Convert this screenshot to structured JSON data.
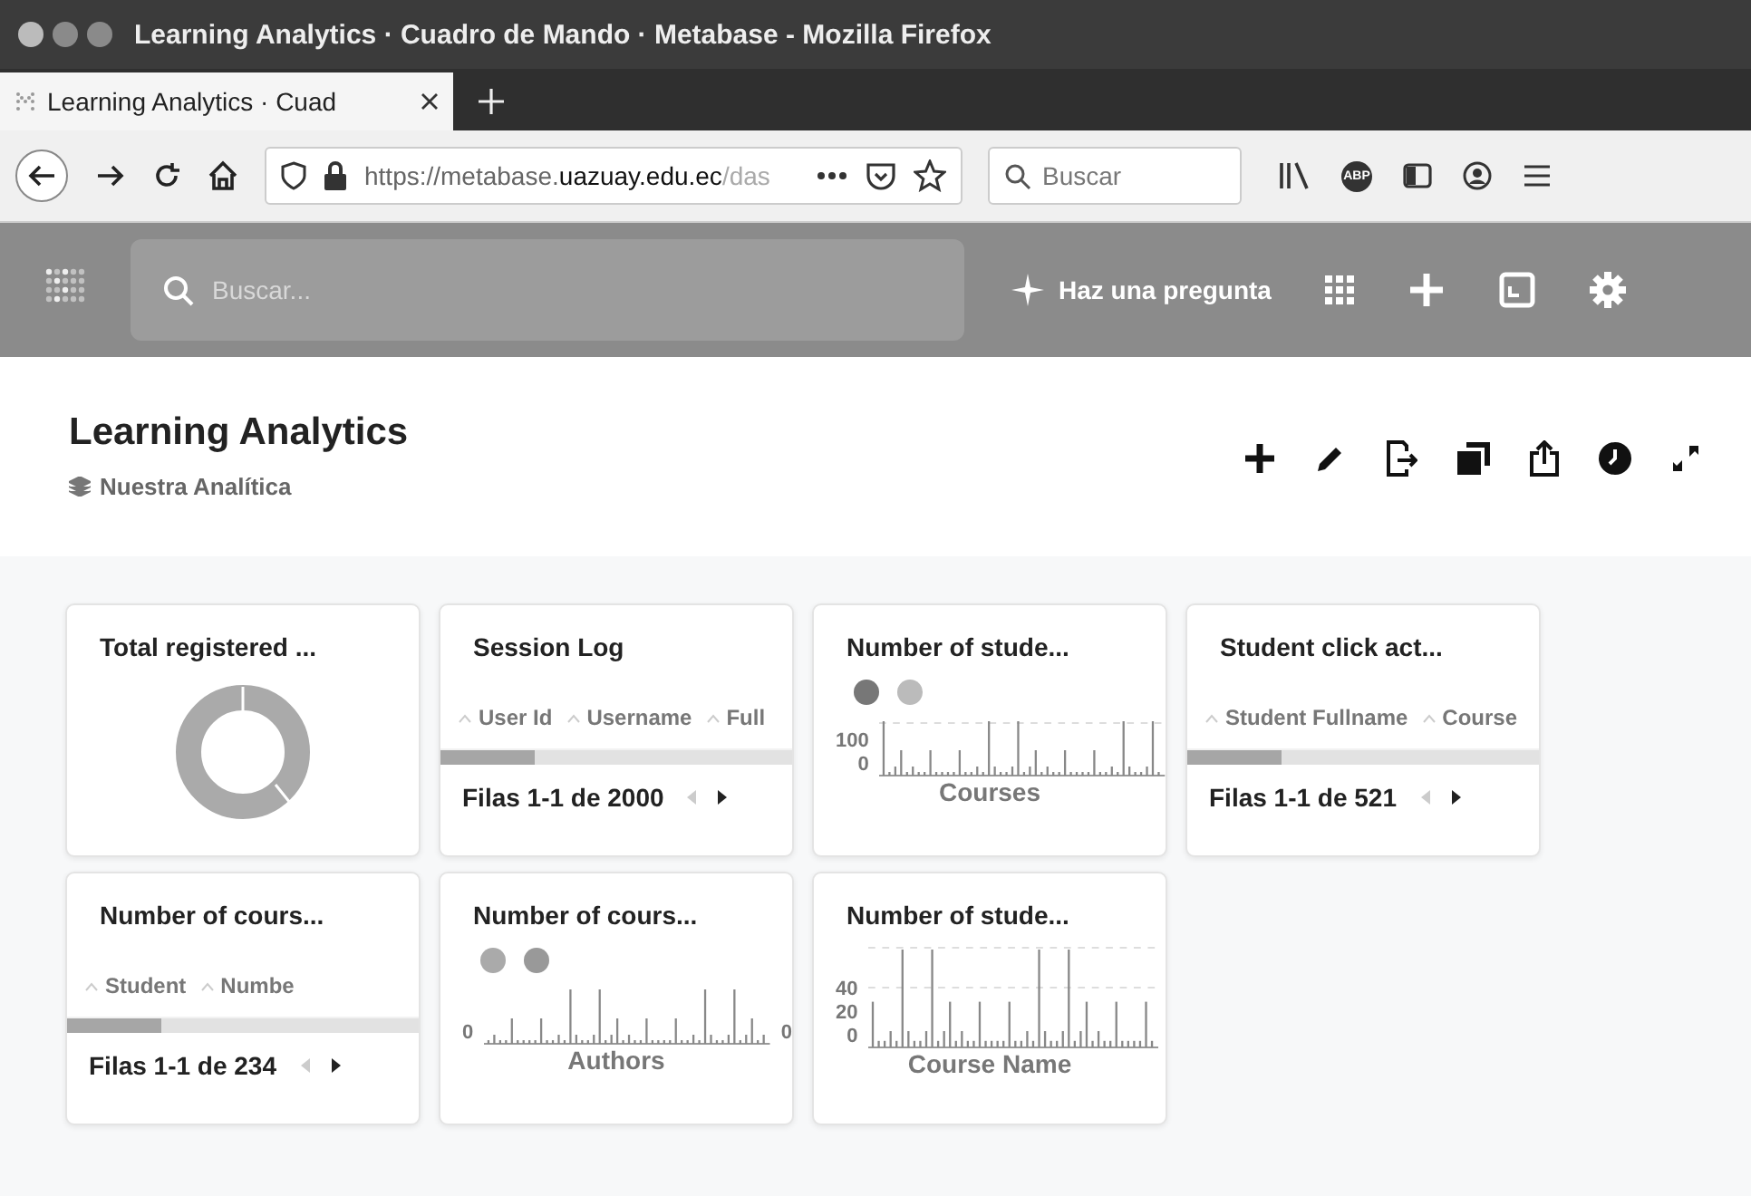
{
  "window": {
    "title": "Learning Analytics · Cuadro de Mando · Metabase - Mozilla Firefox"
  },
  "tabs": [
    {
      "label": "Learning Analytics · Cuad",
      "selected": true
    }
  ],
  "address_bar": {
    "url_prefix": "https://metabase.",
    "url_domain": "uazuay.edu.ec",
    "url_rest": "/das"
  },
  "browser_search": {
    "placeholder": "Buscar"
  },
  "adblock_badge": "ABP",
  "app_header": {
    "search": {
      "placeholder": "Buscar..."
    },
    "ask_button": "Haz una pregunta"
  },
  "dashboard": {
    "title": "Learning Analytics",
    "collection": "Nuestra Analítica"
  },
  "cards": [
    {
      "kind": "donut",
      "title": "Total registered ..."
    },
    {
      "kind": "table",
      "title": "Session Log",
      "columns": [
        "User Id",
        "Username",
        "Full"
      ],
      "footer": "Filas 1-1 de 2000"
    },
    {
      "kind": "bars",
      "title": "Number of stude...",
      "dots": [
        {
          "color": "#777777"
        },
        {
          "color": "#bbbbbb"
        }
      ],
      "yticks": [
        "100",
        "0"
      ],
      "xlabel": "Courses"
    },
    {
      "kind": "table",
      "title": "Student click act...",
      "columns": [
        "Student Fullname",
        "Course"
      ],
      "footer": "Filas 1-1 de 521"
    },
    {
      "kind": "table",
      "title": "Number of cours...",
      "columns": [
        "Student",
        "Numbe"
      ],
      "footer": "Filas 1-1 de 234"
    },
    {
      "kind": "bars",
      "title": "Number of cours...",
      "dots": [
        {
          "color": "#aaaaaa"
        },
        {
          "color": "#999999"
        }
      ],
      "yticks": [
        "0"
      ],
      "right_tick": "0",
      "xlabel": "Authors"
    },
    {
      "kind": "bars",
      "title": "Number of stude...",
      "yticks": [
        "40",
        "20",
        "0"
      ],
      "xlabel": "Course Name"
    }
  ]
}
